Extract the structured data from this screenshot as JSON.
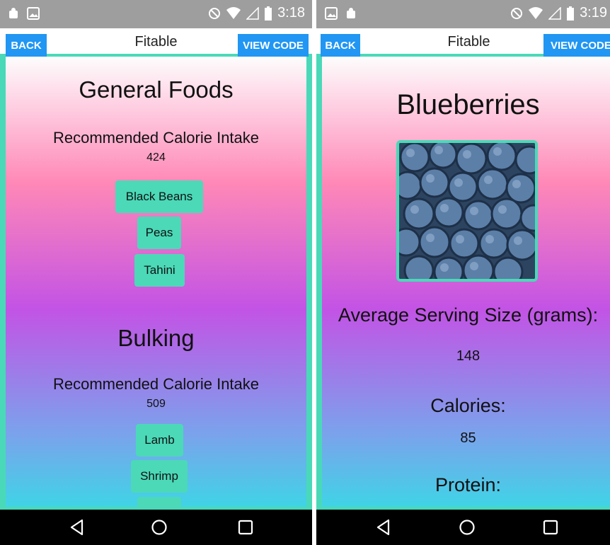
{
  "left_screen": {
    "status": {
      "time": "3:18"
    },
    "appbar": {
      "back_label": "BACK",
      "title": "Fitable",
      "view_code_label": "VIEW CODE"
    },
    "sections": [
      {
        "heading": "General Foods",
        "subheading": "Recommended Calorie Intake",
        "calories": "424",
        "foods": [
          "Black Beans",
          "Peas",
          "Tahini"
        ]
      },
      {
        "heading": "Bulking",
        "subheading": "Recommended Calorie Intake",
        "calories": "509",
        "foods": [
          "Lamb",
          "Shrimp"
        ]
      }
    ]
  },
  "right_screen": {
    "status": {
      "time": "3:19"
    },
    "appbar": {
      "back_label": "BACK",
      "title": "Fitable",
      "view_code_label": "VIEW CODE"
    },
    "food_name": "Blueberries",
    "image_alt": "blueberries-photo",
    "serving_label": "Average Serving Size (grams):",
    "serving_value": "148",
    "calories_label": "Calories:",
    "calories_value": "85",
    "protein_label": "Protein:"
  },
  "colors": {
    "accent": "#4bd9b8",
    "button_blue": "#2196f3",
    "status_gray": "#9e9e9e",
    "gradient": [
      "#fdfdfd",
      "#ff88b7",
      "#c353e5",
      "#7aa3ec",
      "#3fd4e6"
    ]
  },
  "icons": [
    "android-debug-icon",
    "image-icon",
    "do-not-disturb-icon",
    "wifi-icon",
    "signal-icon",
    "battery-icon",
    "back-nav-icon",
    "home-nav-icon",
    "recents-nav-icon"
  ]
}
